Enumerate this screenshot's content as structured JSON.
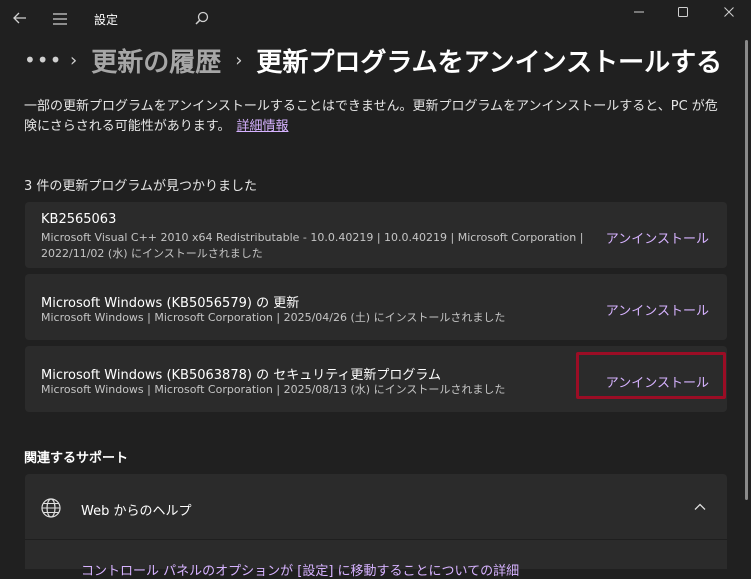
{
  "window": {
    "title": "設定"
  },
  "breadcrumb": {
    "more": "•••",
    "parent": "更新の履歴",
    "current": "更新プログラムをアンインストールする"
  },
  "description": {
    "text": "一部の更新プログラムをアンインストールすることはできません。更新プログラムをアンインストールすると、PC が危険にさらされる可能性があります。",
    "link": "詳細情報"
  },
  "updates": {
    "count_label": "3 件の更新プログラムが見つかりました",
    "items": [
      {
        "title": "KB2565063",
        "meta_line1": "Microsoft Visual C++ 2010  x64 Redistributable - 10.0.40219   |   10.0.40219   |   Microsoft Corporation   |",
        "meta_line2": "2022/11/02 (水) にインストールされました",
        "action": "アンインストール"
      },
      {
        "title": "Microsoft Windows (KB5056579) の 更新",
        "meta_line1": "Microsoft Windows   |   Microsoft Corporation   |   2025/04/26 (土) にインストールされました",
        "action": "アンインストール"
      },
      {
        "title": "Microsoft Windows (KB5063878) の セキュリティ更新プログラム",
        "meta_line1": "Microsoft Windows   |   Microsoft Corporation   |   2025/08/13 (水) にインストールされました",
        "action": "アンインストール"
      }
    ]
  },
  "related": {
    "heading": "関連するサポート",
    "help_title": "Web からのヘルプ",
    "help_link": "コントロール パネルのオプションが [設定] に移動することについての詳細"
  },
  "colors": {
    "background": "#202020",
    "card": "#2b2b2b",
    "accent_link": "#d6b2ff",
    "highlight": "#9b0d25"
  }
}
